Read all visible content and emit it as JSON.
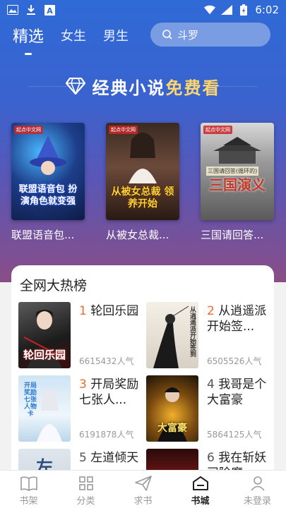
{
  "status_bar": {
    "time": "6:02",
    "icons": [
      "image-icon",
      "download-icon",
      "font-a-icon",
      "wifi-icon",
      "signal-icon",
      "battery-icon"
    ]
  },
  "top_nav": {
    "tabs": [
      {
        "label": "精选",
        "active": true
      },
      {
        "label": "女生",
        "active": false
      },
      {
        "label": "男生",
        "active": false
      }
    ],
    "search_placeholder": "斗罗"
  },
  "promo": {
    "text_white": "经典小说",
    "text_gold": "免费看",
    "icon": "diamond-icon"
  },
  "featured": [
    {
      "title": "联盟语音包...",
      "cover_text": "联盟语音包 扮演角色就变强",
      "publisher": "起点中文网"
    },
    {
      "title": "从被女总裁...",
      "cover_text": "从被女总裁 领养开始",
      "publisher": "起点中文网"
    },
    {
      "title": "三国请回答...",
      "cover_text": "三国演义",
      "cover_banner": "三国请回答(循环的)",
      "publisher": "起点中文网"
    }
  ],
  "ranking": {
    "title": "全网大热榜",
    "items": [
      {
        "rank": "1",
        "title": "轮回乐园",
        "popularity": "6615432人气",
        "cover_text": "轮回乐园"
      },
      {
        "rank": "2",
        "title": "从逍遥派开始签...",
        "popularity": "6505526人气",
        "cover_text": "从逍遥派开始签到"
      },
      {
        "rank": "3",
        "title": "开局奖励七张人...",
        "popularity": "6191878人气",
        "cover_text": "开局奖励七张人物卡"
      },
      {
        "rank": "4",
        "title": "我哥是个大富豪",
        "popularity": "5864125人气",
        "cover_text": "大富豪"
      },
      {
        "rank": "5",
        "title": "左道倾天",
        "popularity": "",
        "cover_text": "左"
      },
      {
        "rank": "6",
        "title": "我在斩妖司除魔",
        "popularity": "",
        "cover_text": ""
      }
    ]
  },
  "bottom_nav": {
    "items": [
      {
        "label": "书架",
        "icon": "book-icon",
        "active": false
      },
      {
        "label": "分类",
        "icon": "grid-icon",
        "active": false
      },
      {
        "label": "求书",
        "icon": "send-icon",
        "active": false
      },
      {
        "label": "书城",
        "icon": "store-icon",
        "active": true
      },
      {
        "label": "未登录",
        "icon": "user-icon",
        "active": false
      }
    ]
  },
  "colors": {
    "accent_gold": "#ffd66b",
    "rank_highlight": "#f06a2b",
    "hero_top": "#2f6ad6",
    "hero_bottom": "#8a4d86"
  }
}
